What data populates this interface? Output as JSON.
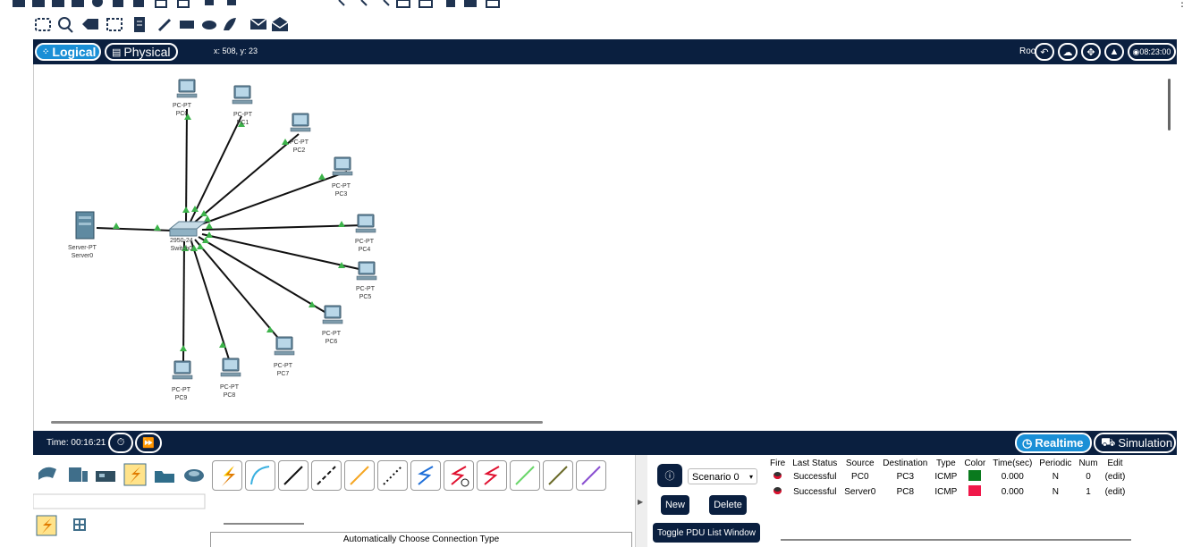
{
  "mode_tabs": {
    "logical": "Logical",
    "physical": "Physical",
    "coords": "x: 508, y: 23"
  },
  "root_label": "Root",
  "clock": "08:23:00",
  "devices": [
    {
      "type": "PC-PT",
      "name": "PC0"
    },
    {
      "type": "PC-PT",
      "name": "PC1"
    },
    {
      "type": "PC-PT",
      "name": "PC2"
    },
    {
      "type": "PC-PT",
      "name": "PC3"
    },
    {
      "type": "PC-PT",
      "name": "PC4"
    },
    {
      "type": "PC-PT",
      "name": "PC5"
    },
    {
      "type": "PC-PT",
      "name": "PC6"
    },
    {
      "type": "PC-PT",
      "name": "PC7"
    },
    {
      "type": "PC-PT",
      "name": "PC8"
    },
    {
      "type": "PC-PT",
      "name": "PC9"
    },
    {
      "type": "Server-PT",
      "name": "Server0"
    },
    {
      "type": "2950-24",
      "name": "Switch0"
    }
  ],
  "timebar": {
    "time": "Time: 00:16:21",
    "realtime": "Realtime",
    "simulation": "Simulation"
  },
  "connection_hint": "Automatically Choose Connection Type",
  "pdu_panel": {
    "scenario": "Scenario 0",
    "new": "New",
    "delete": "Delete",
    "toggle": "Toggle PDU List Window"
  },
  "pdu_table": {
    "headers": [
      "Fire",
      "Last Status",
      "Source",
      "Destination",
      "Type",
      "Color",
      "Time(sec)",
      "Periodic",
      "Num",
      "Edit"
    ],
    "rows": [
      {
        "status": "Successful",
        "source": "PC0",
        "destination": "PC3",
        "type": "ICMP",
        "color": "#0a7a1e",
        "time": "0.000",
        "periodic": "N",
        "num": "0",
        "edit": "(edit)"
      },
      {
        "status": "Successful",
        "source": "Server0",
        "destination": "PC8",
        "type": "ICMP",
        "color": "#f0184a",
        "time": "0.000",
        "periodic": "N",
        "num": "1",
        "edit": "(edit)"
      }
    ]
  },
  "colors": {
    "navy": "#0a1f3f",
    "link_up": "#3cb34a"
  }
}
